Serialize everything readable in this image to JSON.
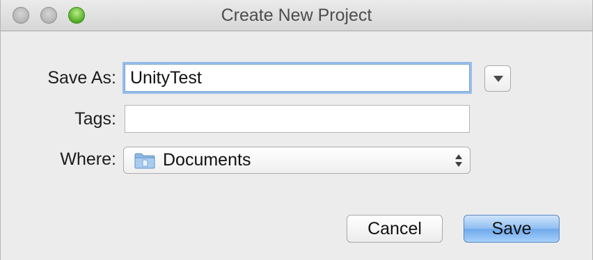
{
  "window": {
    "title": "Create New Project"
  },
  "form": {
    "save_as": {
      "label": "Save As:",
      "value": "UnityTest"
    },
    "tags": {
      "label": "Tags:",
      "value": ""
    },
    "where": {
      "label": "Where:",
      "selected": "Documents",
      "icon": "folder-icon"
    }
  },
  "buttons": {
    "cancel_label": "Cancel",
    "save_label": "Save"
  },
  "colors": {
    "accent": "#6fa8ec",
    "focus_ring": "#97bdea",
    "zoom_green": "#4aa81c"
  }
}
